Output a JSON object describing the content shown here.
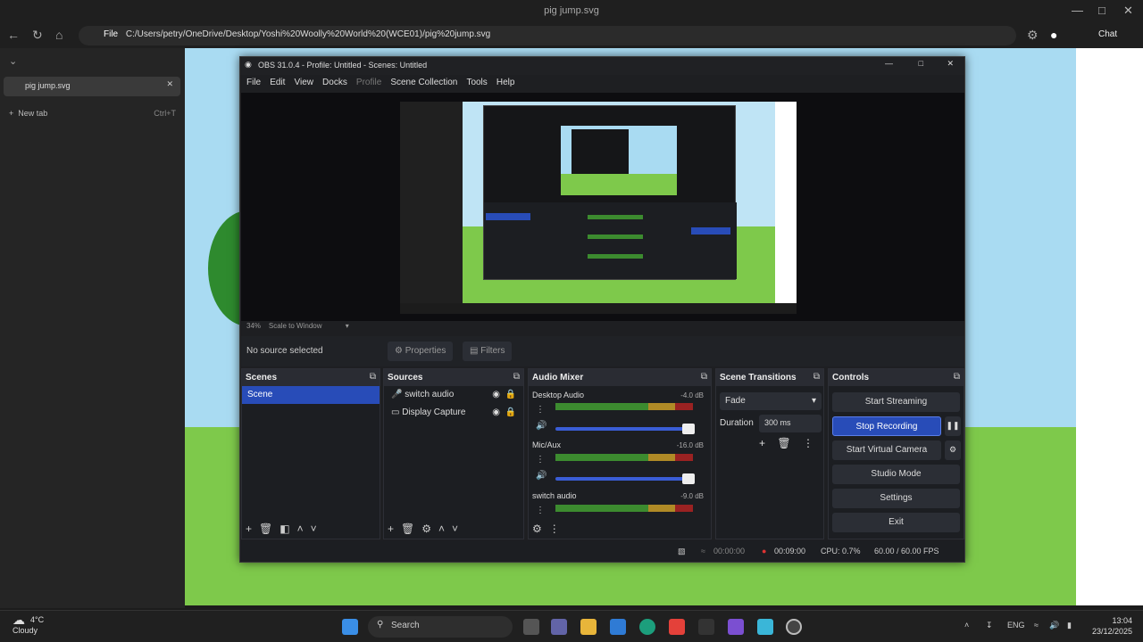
{
  "browser": {
    "title": "pig jump.svg",
    "url_label": "File",
    "url": "C:/Users/petry/OneDrive/Desktop/Yoshi%20Woolly%20World%20(WCE01)/pig%20jump.svg",
    "profile_label": "Chat",
    "tab_label": "pig jump.svg",
    "new_tab_label": "New tab",
    "new_tab_shortcut": "Ctrl+T"
  },
  "obs": {
    "title": "OBS 31.0.4 - Profile: Untitled - Scenes: Untitled",
    "menu": [
      "File",
      "Edit",
      "View",
      "Docks",
      "Profile",
      "Scene Collection",
      "Tools",
      "Help"
    ],
    "zoom": "34%",
    "scale_mode": "Scale to Window",
    "no_source": "No source selected",
    "properties_label": "Properties",
    "filters_label": "Filters",
    "scenes": {
      "title": "Scenes",
      "items": [
        "Scene"
      ]
    },
    "sources": {
      "title": "Sources",
      "items": [
        {
          "icon": "microphone-icon",
          "label": "switch audio"
        },
        {
          "icon": "monitor-icon",
          "label": "Display Capture"
        }
      ]
    },
    "mixer": {
      "title": "Audio Mixer",
      "channels": [
        {
          "name": "Desktop Audio",
          "value": "-4.0 dB"
        },
        {
          "name": "Mic/Aux",
          "value": "-16.0 dB"
        },
        {
          "name": "switch audio",
          "value": "-9.0 dB"
        }
      ]
    },
    "transitions": {
      "title": "Scene Transitions",
      "selected": "Fade",
      "duration_label": "Duration",
      "duration_value": "300 ms"
    },
    "controls": {
      "title": "Controls",
      "buttons": [
        "Start Streaming",
        "Stop Recording",
        "Start Virtual Camera",
        "Studio Mode",
        "Settings",
        "Exit"
      ]
    },
    "status": {
      "stream_time": "00:00:00",
      "rec_time": "00:09:00",
      "cpu": "CPU: 0.7%",
      "fps": "60.00 / 60.00 FPS"
    }
  },
  "taskbar": {
    "temp": "4°C",
    "weather": "Cloudy",
    "search_placeholder": "Search",
    "lang": "ENG",
    "time": "13:04",
    "date": "23/12/2025"
  }
}
